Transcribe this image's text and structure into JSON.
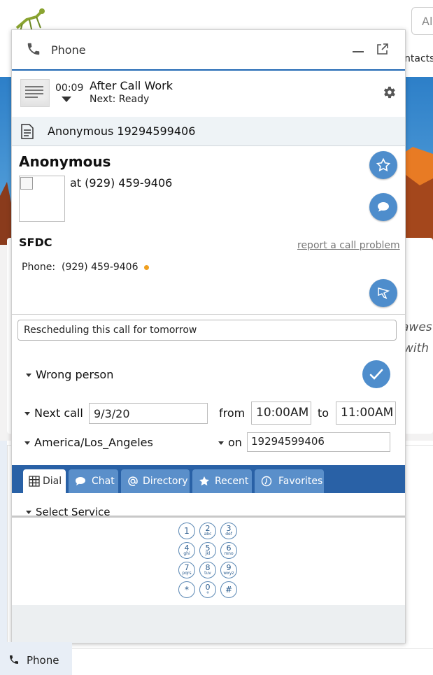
{
  "background": {
    "search_placeholder": "All",
    "nav_label": "ntacts",
    "text_line1": "awes",
    "text_line2": "with"
  },
  "panel": {
    "title": "Phone",
    "status": {
      "timer": "00:09",
      "state": "After Call Work",
      "next": "Next: Ready"
    },
    "call": {
      "caller": "Anonymous 19294599406"
    },
    "contact": {
      "name": "Anonymous",
      "at_number": "at (929) 459-9406",
      "source": "SFDC",
      "report_link": "report a call problem",
      "phone_label": "Phone:",
      "phone_value": "(929) 459-9406"
    },
    "notes": {
      "value": "Rescheduling this call for tomorrow"
    },
    "disposition": {
      "value": "Wrong person"
    },
    "callback": {
      "next_call_label": "Next call",
      "date": "9/3/20",
      "from_label": "from",
      "from_time": "10:00AM",
      "to_label": "to",
      "to_time": "11:00AM",
      "timezone": "America/Los_Angeles",
      "on_label": "on",
      "on_number": "19294599406"
    },
    "tabs": [
      {
        "label": "Dial",
        "icon": "grid-icon"
      },
      {
        "label": "Chat",
        "icon": "chat-bubble-icon"
      },
      {
        "label": "Directory",
        "icon": "at-icon"
      },
      {
        "label": "Recent",
        "icon": "star-icon"
      },
      {
        "label": "Favorites",
        "icon": "clock-icon"
      }
    ],
    "select_service": "Select Service",
    "dialpad": [
      {
        "digit": "1",
        "letters": ""
      },
      {
        "digit": "2",
        "letters": "abc"
      },
      {
        "digit": "3",
        "letters": "def"
      },
      {
        "digit": "4",
        "letters": "ghi"
      },
      {
        "digit": "5",
        "letters": "jkl"
      },
      {
        "digit": "6",
        "letters": "mno"
      },
      {
        "digit": "7",
        "letters": "pqrs"
      },
      {
        "digit": "8",
        "letters": "tuv"
      },
      {
        "digit": "9",
        "letters": "wxyz"
      },
      {
        "digit": "*",
        "letters": ""
      },
      {
        "digit": "0",
        "letters": "+"
      },
      {
        "digit": "#",
        "letters": ""
      }
    ]
  },
  "dock": {
    "label": "Phone"
  },
  "colors": {
    "accent_blue": "#1f67b3",
    "tab_bar": "#2961a6",
    "button_blue": "#4e8dcc",
    "status_dot": "#f0a020"
  }
}
